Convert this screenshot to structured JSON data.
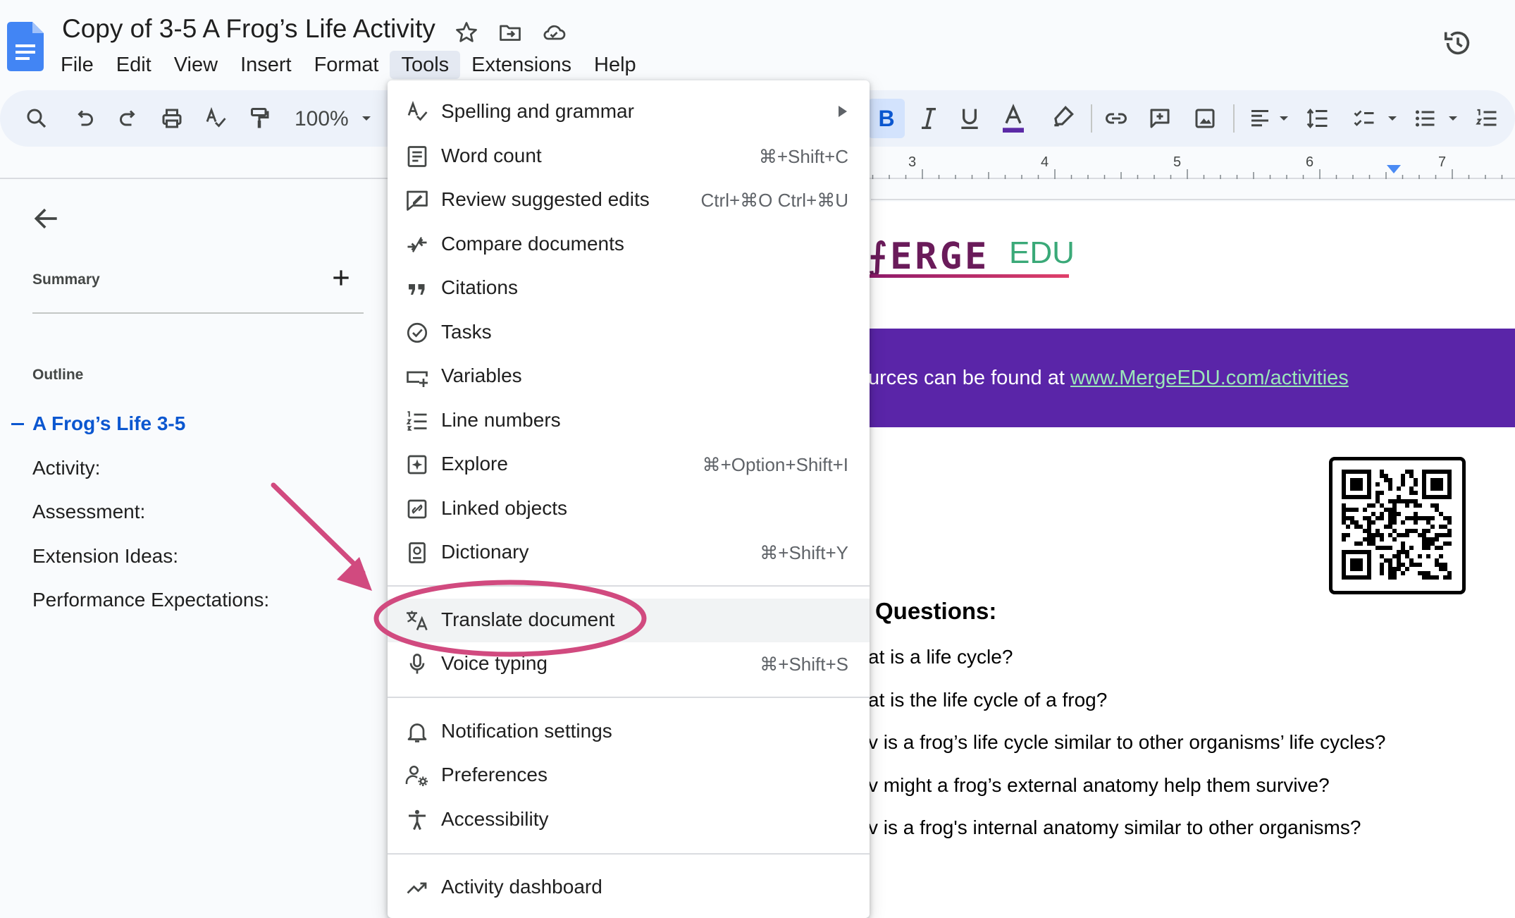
{
  "app": {
    "title": "Copy of 3-5 A Frog’s Life Activity",
    "menus": [
      "File",
      "Edit",
      "View",
      "Insert",
      "Format",
      "Tools",
      "Extensions",
      "Help"
    ],
    "active_menu": "Tools"
  },
  "toolbar": {
    "zoom": "100%",
    "bold_label": "B"
  },
  "ruler": {
    "numbers": [
      "3",
      "4",
      "5",
      "6",
      "7"
    ]
  },
  "outline_panel": {
    "summary_label": "Summary",
    "outline_label": "Outline",
    "items": [
      {
        "label": "A Frog’s Life 3-5",
        "active": true
      },
      {
        "label": "Activity:"
      },
      {
        "label": "Assessment:"
      },
      {
        "label": "Extension Ideas:"
      },
      {
        "label": "Performance Expectations:"
      }
    ]
  },
  "document": {
    "logo_text": "⨍ERGE",
    "logo_edu": "EDU",
    "banner_prefix": "urces can be found at ",
    "banner_link": "www.MergeEDU.com/activities",
    "questions_heading": "Questions:",
    "questions": [
      "at is a life cycle?",
      "at is the life cycle of a frog?",
      "v is a frog’s life cycle similar to other organisms’ life cycles?",
      "v might a frog’s external anatomy help them survive?",
      "v is a frog's internal anatomy similar to other organisms?"
    ]
  },
  "tools_menu": {
    "items": [
      {
        "label": "Spelling and grammar",
        "icon": "spellcheck-icon",
        "submenu": true
      },
      {
        "label": "Word count",
        "icon": "word-count-icon",
        "shortcut": "⌘+Shift+C"
      },
      {
        "label": "Review suggested edits",
        "icon": "review-edits-icon",
        "shortcut": "Ctrl+⌘O Ctrl+⌘U"
      },
      {
        "label": "Compare documents",
        "icon": "compare-icon"
      },
      {
        "label": "Citations",
        "icon": "quote-icon"
      },
      {
        "label": "Tasks",
        "icon": "task-check-icon"
      },
      {
        "label": "Variables",
        "icon": "variables-icon"
      },
      {
        "label": "Line numbers",
        "icon": "line-numbers-icon"
      },
      {
        "label": "Explore",
        "icon": "explore-icon",
        "shortcut": "⌘+Option+Shift+I"
      },
      {
        "label": "Linked objects",
        "icon": "linked-objects-icon"
      },
      {
        "label": "Dictionary",
        "icon": "dictionary-icon",
        "shortcut": "⌘+Shift+Y"
      },
      {
        "label": "Translate document",
        "icon": "translate-icon",
        "highlighted": true
      },
      {
        "label": "Voice typing",
        "icon": "microphone-icon",
        "shortcut": "⌘+Shift+S"
      },
      {
        "label": "Notification settings",
        "icon": "bell-icon"
      },
      {
        "label": "Preferences",
        "icon": "preferences-icon"
      },
      {
        "label": "Accessibility",
        "icon": "accessibility-icon"
      },
      {
        "label": "Activity dashboard",
        "icon": "trending-up-icon"
      }
    ]
  },
  "annotation": {
    "color": "#d14a7f"
  }
}
